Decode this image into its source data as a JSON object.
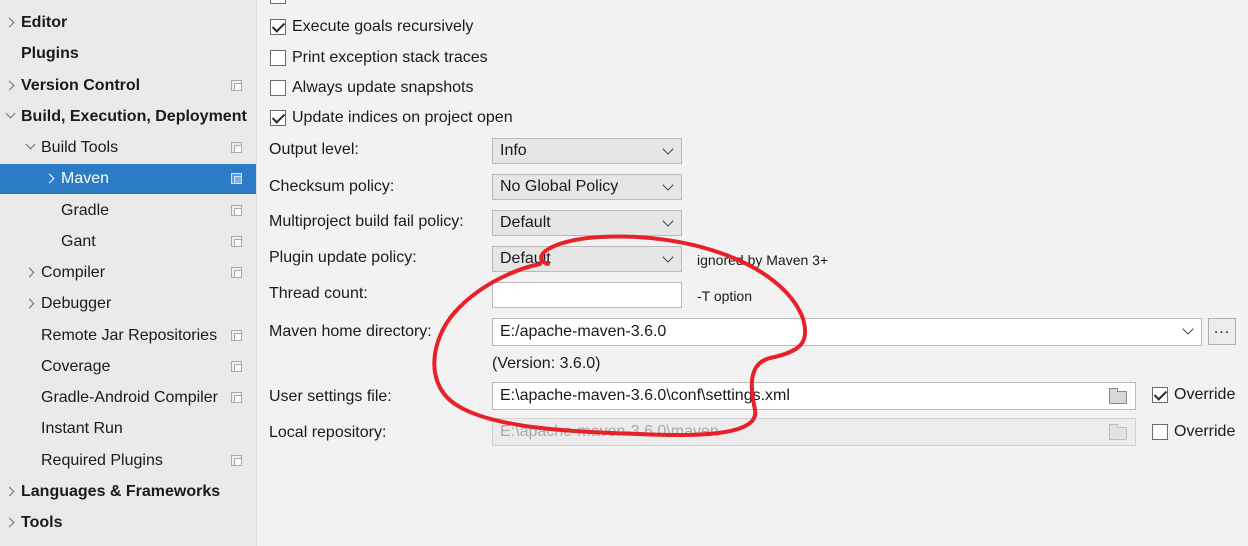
{
  "sidebar": {
    "items": [
      {
        "label": "Editor"
      },
      {
        "label": "Plugins"
      },
      {
        "label": "Version Control"
      },
      {
        "label": "Build, Execution, Deployment"
      },
      {
        "label": "Build Tools"
      },
      {
        "label": "Maven"
      },
      {
        "label": "Gradle"
      },
      {
        "label": "Gant"
      },
      {
        "label": "Compiler"
      },
      {
        "label": "Debugger"
      },
      {
        "label": "Remote Jar Repositories"
      },
      {
        "label": "Coverage"
      },
      {
        "label": "Gradle-Android Compiler"
      },
      {
        "label": "Instant Run"
      },
      {
        "label": "Required Plugins"
      },
      {
        "label": "Languages & Frameworks"
      },
      {
        "label": "Tools"
      }
    ]
  },
  "options": {
    "execute_recursively": {
      "label": "Execute goals recursively",
      "checked": true
    },
    "print_exception": {
      "label": "Print exception stack traces",
      "checked": false
    },
    "always_update": {
      "label": "Always update snapshots",
      "checked": false
    },
    "update_indices": {
      "label": "Update indices on project open",
      "checked": true
    }
  },
  "fields": {
    "output_level": {
      "label": "Output level:",
      "value": "Info"
    },
    "checksum_policy": {
      "label": "Checksum policy:",
      "value": "No Global Policy"
    },
    "multiproject_fail": {
      "label": "Multiproject build fail policy:",
      "value": "Default"
    },
    "plugin_update": {
      "label": "Plugin update policy:",
      "value": "Default",
      "hint": "ignored by Maven 3+"
    },
    "thread_count": {
      "label": "Thread count:",
      "value": "",
      "hint": "-T option"
    },
    "maven_home": {
      "label": "Maven home directory:",
      "value": "E:/apache-maven-3.6.0",
      "version": "(Version: 3.6.0)",
      "browse": "..."
    },
    "user_settings": {
      "label": "User settings file:",
      "value": "E:\\apache-maven-3.6.0\\conf\\settings.xml",
      "override_label": "Override",
      "override": true
    },
    "local_repo": {
      "label": "Local repository:",
      "value": "E:\\apache-maven-3.6.0\\maven",
      "override_label": "Override",
      "override": false
    }
  },
  "colors": {
    "selection": "#2b7bc7",
    "annotation": "#e8202a"
  }
}
